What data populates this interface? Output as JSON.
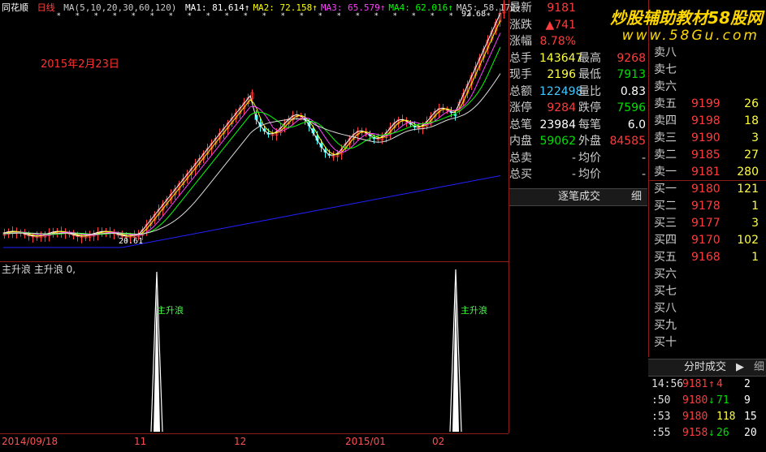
{
  "app": {
    "name": "同花顺",
    "period": "日线"
  },
  "ma_header": {
    "ma_spec": "MA(5,10,20,30,60,120)",
    "items": [
      {
        "label": "MA1:",
        "value": "81.614",
        "color": "#ffffff"
      },
      {
        "label": "MA2:",
        "value": "72.158",
        "color": "#ffff00"
      },
      {
        "label": "MA3:",
        "value": "65.579",
        "color": "#ff40ff"
      },
      {
        "label": "MA4:",
        "value": "62.016",
        "color": "#00ff00"
      },
      {
        "label": "MA5:",
        "value": "58.172",
        "color": "#cccccc"
      }
    ]
  },
  "annotation_date": "2015年2月23日",
  "price_labels": {
    "high": "92.68",
    "low": "20.61"
  },
  "indicator": {
    "name": "主升浪",
    "header": "主升浪 主升浪  0,",
    "signal_label": "主升浪"
  },
  "axis_dates": [
    "2014/09/18",
    "11",
    "12",
    "2015/01",
    "02"
  ],
  "quote": {
    "rows": [
      {
        "l1": "最新",
        "v1": "9181",
        "c1": "#ff3c3c",
        "l2": "",
        "v2": "",
        "c2": "#ccc"
      },
      {
        "l1": "涨跌",
        "v1": "▲741",
        "c1": "#ff3c3c",
        "l2": "",
        "v2": "",
        "c2": "#ccc"
      },
      {
        "l1": "涨幅",
        "v1": "8.78%",
        "c1": "#ff3c3c",
        "l2": "",
        "v2": "",
        "c2": "#ccc"
      },
      {
        "l1": "总手",
        "v1": "143647",
        "c1": "#ffff40",
        "l2": "最高",
        "v2": "9268",
        "c2": "#ff3c3c"
      },
      {
        "l1": "现手",
        "v1": "2196",
        "c1": "#ffff40",
        "l2": "最低",
        "v2": "7913",
        "c2": "#00e000"
      },
      {
        "l1": "总额",
        "v1": "122498",
        "c1": "#40c8ff",
        "l2": "量比",
        "v2": "0.83",
        "c2": "#ffffff"
      },
      {
        "l1": "涨停",
        "v1": "9284",
        "c1": "#ff3c3c",
        "l2": "跌停",
        "v2": "7596",
        "c2": "#00e000"
      },
      {
        "l1": "总笔",
        "v1": "23984",
        "c1": "#ffffff",
        "l2": "每笔",
        "v2": "6.0",
        "c2": "#ffffff"
      },
      {
        "l1": "内盘",
        "v1": "59062",
        "c1": "#00e000",
        "l2": "外盘",
        "v2": "84585",
        "c2": "#ff3c3c"
      },
      {
        "l1": "总卖",
        "v1": "-",
        "c1": "#ccc",
        "l2": "均价",
        "v2": "-",
        "c2": "#ccc"
      },
      {
        "l1": "总买",
        "v1": "-",
        "c1": "#ccc",
        "l2": "均价",
        "v2": "-",
        "c2": "#ccc"
      }
    ],
    "tab_trades": "逐笔成交",
    "tab_detail": "细"
  },
  "order_book": [
    {
      "label": "卖八",
      "price": "",
      "vol": ""
    },
    {
      "label": "卖七",
      "price": "",
      "vol": ""
    },
    {
      "label": "卖六",
      "price": "",
      "vol": ""
    },
    {
      "label": "卖五",
      "price": "9199",
      "vol": "26"
    },
    {
      "label": "卖四",
      "price": "9198",
      "vol": "18"
    },
    {
      "label": "卖三",
      "price": "9190",
      "vol": "3"
    },
    {
      "label": "卖二",
      "price": "9185",
      "vol": "27"
    },
    {
      "label": "卖一",
      "price": "9181",
      "vol": "280"
    },
    {
      "label": "买一",
      "price": "9180",
      "vol": "121"
    },
    {
      "label": "买二",
      "price": "9178",
      "vol": "1"
    },
    {
      "label": "买三",
      "price": "9177",
      "vol": "3"
    },
    {
      "label": "买四",
      "price": "9170",
      "vol": "102"
    },
    {
      "label": "买五",
      "price": "9168",
      "vol": "1"
    },
    {
      "label": "买六",
      "price": "",
      "vol": ""
    },
    {
      "label": "买七",
      "price": "",
      "vol": ""
    },
    {
      "label": "买八",
      "price": "",
      "vol": ""
    },
    {
      "label": "买九",
      "price": "",
      "vol": ""
    },
    {
      "label": "买十",
      "price": "",
      "vol": ""
    }
  ],
  "ticks": {
    "tab_label": "分时成交",
    "rows": [
      {
        "time": "14:56",
        "price": "9181",
        "arrow": "↑",
        "vol": "4",
        "n": "2",
        "color": "#ff3c3c"
      },
      {
        "time": ":50",
        "price": "9180",
        "arrow": "↓",
        "vol": "71",
        "n": "9",
        "color": "#00e000"
      },
      {
        "time": ":53",
        "price": "9180",
        "arrow": "",
        "vol": "118",
        "n": "15",
        "color": "#ffff40"
      },
      {
        "time": ":55",
        "price": "9158",
        "arrow": "↓",
        "vol": "26",
        "n": "20",
        "color": "#00e000"
      }
    ]
  },
  "watermark": {
    "line1": "炒股辅助教材58股网",
    "line2": "www.58Gu.com"
  }
}
